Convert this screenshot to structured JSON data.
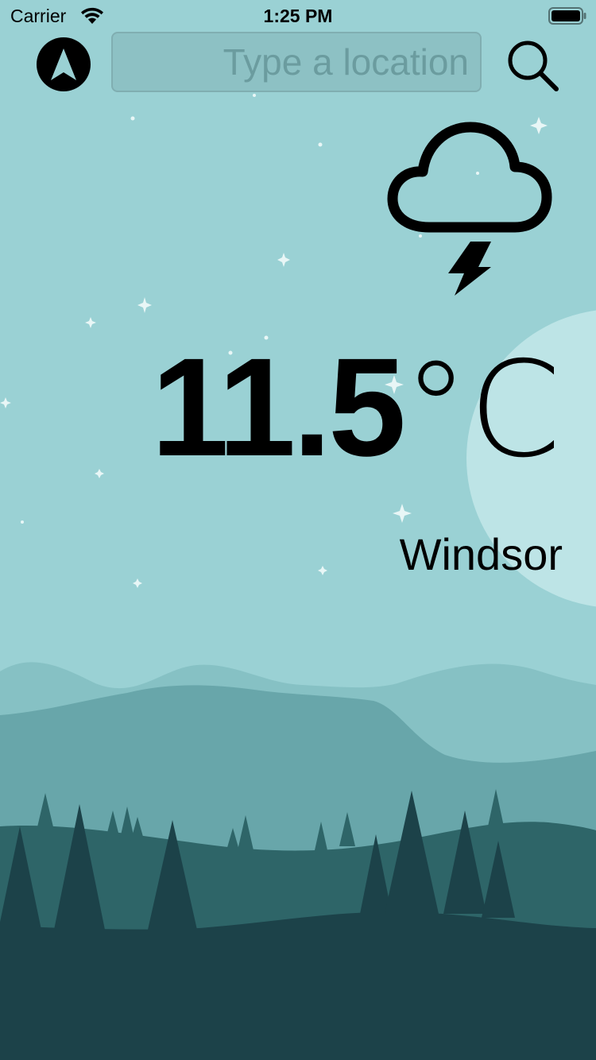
{
  "status_bar": {
    "carrier": "Carrier",
    "time": "1:25 PM",
    "wifi_icon": "wifi-icon",
    "battery_icon": "battery-icon"
  },
  "toolbar": {
    "location_icon": "navigation-arrow-icon",
    "search": {
      "value": "",
      "placeholder": "Type a location"
    },
    "search_icon": "magnifier-icon"
  },
  "weather": {
    "condition_icon": "cloud-lightning-icon",
    "temperature": "11.5",
    "unit": "°C",
    "city": "Windsor"
  },
  "colors": {
    "sky": "#9ad1d4",
    "moon": "#bde4e6",
    "far_hills": "#86c1c4",
    "mid_hills": "#68a6aa",
    "near_hills": "#2e6568",
    "foreground": "#1c4249"
  }
}
